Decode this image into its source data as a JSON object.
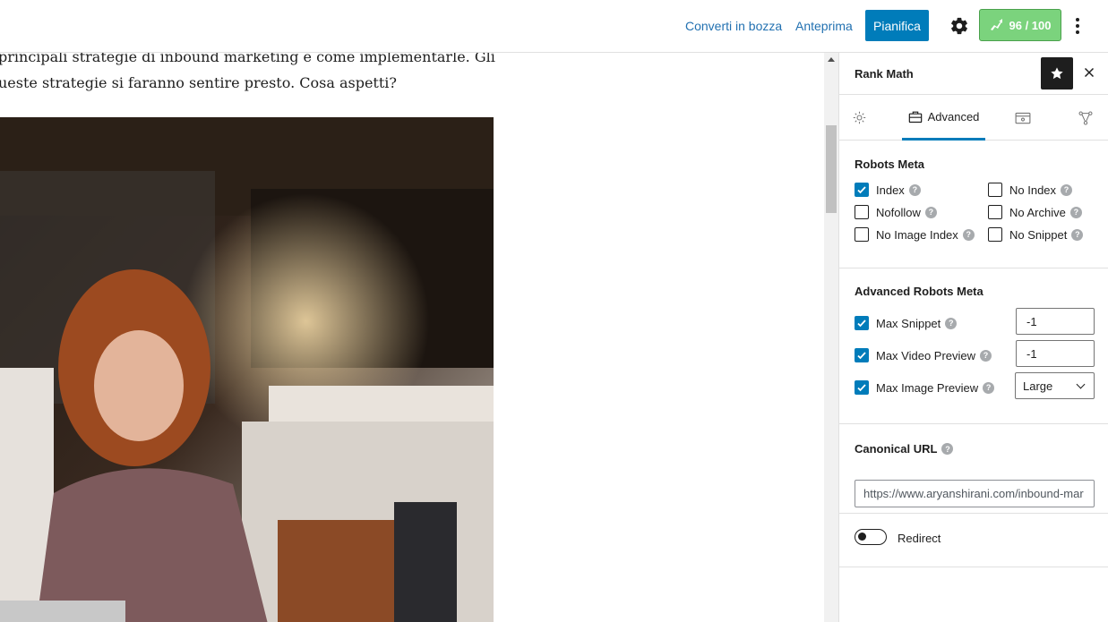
{
  "toolbar": {
    "switch_to_draft": "Converti in bozza",
    "preview": "Anteprima",
    "schedule": "Pianifica",
    "settings_icon": "gear-icon",
    "score": "96 / 100",
    "score_color": "#7bd37d",
    "more_icon": "vertical-ellipsis-icon"
  },
  "editor": {
    "line1": "principali strategie di inbound marketing e come implementarle. Gli",
    "line2": "ueste strategie si faranno sentire presto. Cosa aspetti?",
    "image_icon": "photo-woman-laptop-cafe"
  },
  "sidebar": {
    "title": "Rank Math",
    "tabs": {
      "general_icon": "gear-icon",
      "advanced_label": "Advanced",
      "advanced_icon": "toolbox-icon",
      "schema_icon": "schema-icon",
      "social_icon": "share-network-icon"
    },
    "robots_meta": {
      "title": "Robots Meta",
      "options": [
        {
          "label": "Index",
          "checked": true
        },
        {
          "label": "No Index",
          "checked": false
        },
        {
          "label": "Nofollow",
          "checked": false
        },
        {
          "label": "No Archive",
          "checked": false
        },
        {
          "label": "No Image Index",
          "checked": false
        },
        {
          "label": "No Snippet",
          "checked": false
        }
      ]
    },
    "advanced_robots": {
      "title": "Advanced Robots Meta",
      "max_snippet": {
        "label": "Max Snippet",
        "checked": true,
        "value": "-1"
      },
      "max_video_preview": {
        "label": "Max Video Preview",
        "checked": true,
        "value": "-1"
      },
      "max_image_preview": {
        "label": "Max Image Preview",
        "checked": true,
        "value": "Large"
      }
    },
    "canonical": {
      "label": "Canonical URL",
      "placeholder": "https://www.aryanshirani.com/inbound-mar"
    },
    "redirect": {
      "label": "Redirect",
      "enabled": false
    },
    "accent_color": "#007cba"
  }
}
